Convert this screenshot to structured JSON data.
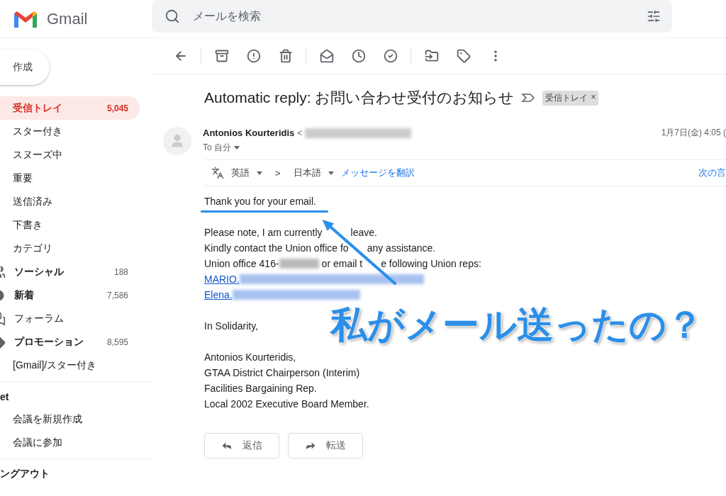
{
  "app": {
    "name": "Gmail"
  },
  "search": {
    "placeholder": "メールを検索"
  },
  "compose": {
    "label": "作成"
  },
  "sidebar": {
    "items": [
      {
        "label": "受信トレイ",
        "count": "5,045",
        "selected": true,
        "bold": true,
        "kind": "folder"
      },
      {
        "label": "スター付き",
        "selected": false,
        "bold": false,
        "kind": "folder"
      },
      {
        "label": "スヌーズ中",
        "selected": false,
        "bold": false,
        "kind": "folder"
      },
      {
        "label": "重要",
        "selected": false,
        "bold": false,
        "kind": "folder"
      },
      {
        "label": "送信済み",
        "selected": false,
        "bold": false,
        "kind": "folder"
      },
      {
        "label": "下書き",
        "selected": false,
        "bold": false,
        "kind": "folder"
      },
      {
        "label": "カテゴリ",
        "selected": false,
        "bold": false,
        "kind": "folder"
      },
      {
        "label": "ソーシャル",
        "count": "188",
        "selected": false,
        "bold": true,
        "kind": "social"
      },
      {
        "label": "新着",
        "count": "7,586",
        "selected": false,
        "bold": true,
        "kind": "updates"
      },
      {
        "label": "フォーラム",
        "selected": false,
        "bold": false,
        "kind": "forums"
      },
      {
        "label": "プロモーション",
        "count": "8,595",
        "selected": false,
        "bold": true,
        "kind": "promotions"
      },
      {
        "label": "[Gmail]/スター付き",
        "selected": false,
        "bold": false,
        "kind": "label"
      }
    ],
    "meet": {
      "title": "et",
      "items": [
        "会議を新規作成",
        "会議に参加"
      ]
    },
    "hangouts": {
      "title": "ングアウト"
    }
  },
  "message": {
    "subject": "Automatic reply: お問い合わせ受付のお知らせ",
    "label_chip": "受信トレイ",
    "label_remove": "×",
    "sender": "Antonios Kourteridis",
    "sender_bracket": "<",
    "to": "To 自分",
    "date": "1月7日(金) 4:05 (",
    "translate": {
      "from": "英語",
      "arrow": ">",
      "to": "日本語",
      "action": "メッセージを翻訳",
      "next": "次の言"
    },
    "body": [
      {
        "kind": "text",
        "text": "Thank you for your email."
      },
      {
        "kind": "blank"
      },
      {
        "kind": "split",
        "parts": [
          "Please note, I am currently",
          "leave."
        ]
      },
      {
        "kind": "split",
        "parts": [
          "Kindly contact the Union office fo",
          "any assistance."
        ]
      },
      {
        "kind": "redacted",
        "before": "Union office 416-",
        "parts": [
          "or email t",
          "e following Union reps:"
        ]
      },
      {
        "kind": "link",
        "text": "MARIO."
      },
      {
        "kind": "link",
        "text": "Elena."
      },
      {
        "kind": "blank"
      },
      {
        "kind": "text",
        "text": "In Solidarity,"
      },
      {
        "kind": "blank"
      },
      {
        "kind": "text",
        "text": "Antonios Kourteridis,"
      },
      {
        "kind": "text",
        "text": "GTAA District Chairperson (Interim)"
      },
      {
        "kind": "text",
        "text": "Facilities Bargaining Rep."
      },
      {
        "kind": "text",
        "text": "Local 2002 Executive Board Member."
      }
    ],
    "actions": [
      {
        "kind": "reply",
        "label": "返信"
      },
      {
        "kind": "forward",
        "label": "転送"
      }
    ]
  },
  "annotation": {
    "callout": "私がメール送ったの？"
  }
}
